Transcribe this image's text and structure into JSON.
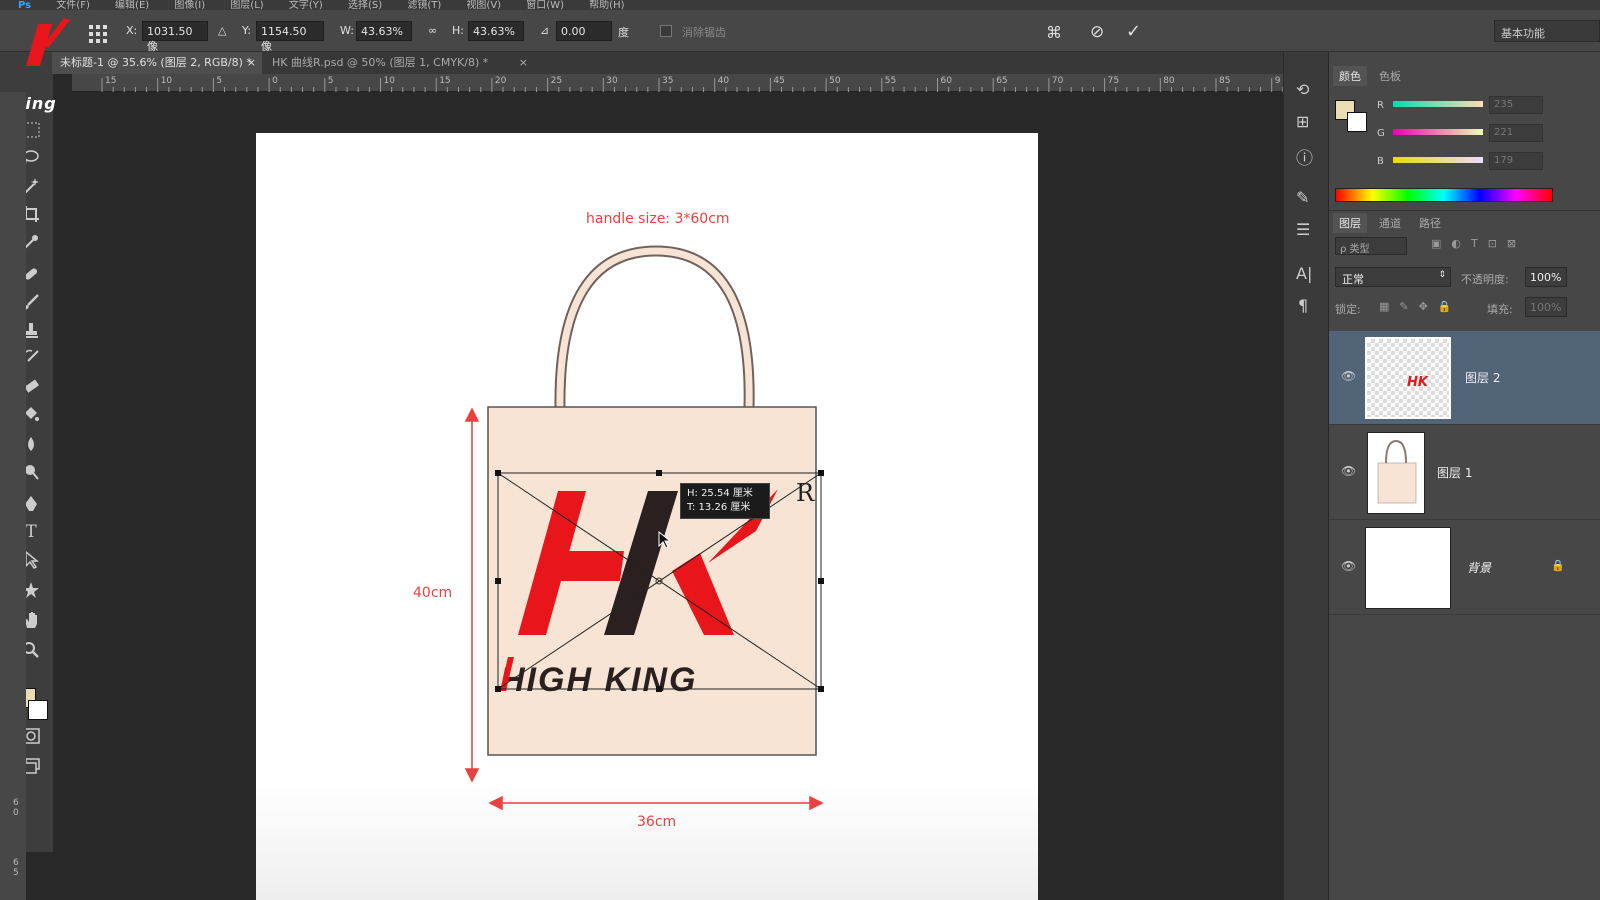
{
  "menubar": {
    "app_logo": "Ps",
    "items": [
      "文件(F)",
      "编辑(E)",
      "图像(I)",
      "图层(L)",
      "文字(Y)",
      "选择(S)",
      "滤镜(T)",
      "视图(V)",
      "窗口(W)",
      "帮助(H)"
    ]
  },
  "options_bar": {
    "x_label": "X:",
    "x_value": "1031.50 像",
    "y_label": "Y:",
    "y_value": "1154.50 像",
    "w_label": "W:",
    "w_value": "43.63%",
    "h_label": "H:",
    "h_value": "43.63%",
    "angle_value": "0.00",
    "angle_unit": "度",
    "interp_label": "消除锯齿",
    "workspace": "基本功能"
  },
  "tabs": [
    {
      "label": "未标题-1 @ 35.6% (图层 2, RGB/8) *",
      "close": "×"
    },
    {
      "label": "HK 曲线R.psd @ 50% (图层 1, CMYK/8) *",
      "close": "×"
    }
  ],
  "ruler": {
    "h_ticks": [
      "15",
      "10",
      "5",
      "0",
      "5",
      "10",
      "15",
      "20",
      "25",
      "30",
      "35",
      "40",
      "45",
      "50",
      "55",
      "60",
      "65",
      "70",
      "75",
      "80",
      "85",
      "9"
    ],
    "v_ticks": [
      "6",
      "0",
      "6",
      "5"
    ]
  },
  "watermark": {
    "text": "King"
  },
  "canvas": {
    "handle_label": "handle size: 3*60cm",
    "height_label": "40cm",
    "width_label": "36cm",
    "brand_text": "HIGH KING",
    "logo_letters": "HK",
    "registered": "R",
    "tooltip_line1": "H: 25.54 厘米",
    "tooltip_line2": "T: 13.26 厘米",
    "colors": {
      "bag": "#f7e4d4",
      "bag_stroke": "#555555",
      "handle_stroke": "#7a6a60",
      "red": "#e8161b",
      "dark": "#2b2020",
      "dim_red": "#e8413f"
    }
  },
  "color_panel": {
    "tabs": [
      "颜色",
      "色板"
    ],
    "r_label": "R",
    "r_value": "235",
    "g_label": "G",
    "g_value": "221",
    "b_label": "B",
    "b_value": "179",
    "foreground": "#ebddb3"
  },
  "layers_panel": {
    "tabs": [
      "图层",
      "通道",
      "路径"
    ],
    "filter_label": "ρ 类型",
    "blend_mode": "正常",
    "opacity_label": "不透明度:",
    "opacity_value": "100%",
    "lock_label": "锁定:",
    "fill_label": "填充:",
    "fill_value": "100%",
    "layers": [
      {
        "name": "图层 2",
        "thumb_text": "HK"
      },
      {
        "name": "图层 1"
      },
      {
        "name": "背景"
      }
    ]
  }
}
